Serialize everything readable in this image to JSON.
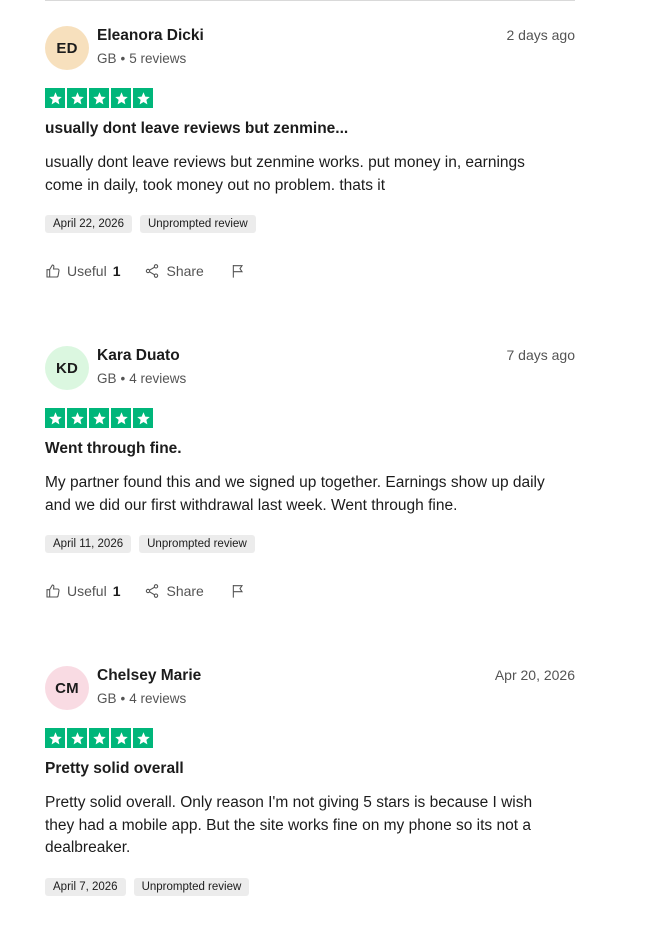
{
  "reviews": [
    {
      "initials": "ED",
      "avatar_color": "#f7e0bd",
      "name": "Eleanora Dicki",
      "country": "GB",
      "review_count": "5 reviews",
      "date": "2 days ago",
      "stars": 5,
      "title": "usually dont leave reviews but zenmine...",
      "body": "usually dont leave reviews but zenmine works. put money in, earnings come in daily, took money out no problem. thats it",
      "experience_date": "April 22, 2026",
      "tag": "Unprompted review",
      "useful_label": "Useful",
      "useful_count": "1",
      "share_label": "Share"
    },
    {
      "initials": "KD",
      "avatar_color": "#dbf7e0",
      "name": "Kara Duato",
      "country": "GB",
      "review_count": "4 reviews",
      "date": "7 days ago",
      "stars": 5,
      "title": "Went through fine.",
      "body": "My partner found this and we signed up together. Earnings show up daily and we did our first withdrawal last week. Went through fine.",
      "experience_date": "April 11, 2026",
      "tag": "Unprompted review",
      "useful_label": "Useful",
      "useful_count": "1",
      "share_label": "Share"
    },
    {
      "initials": "CM",
      "avatar_color": "#f9dbe3",
      "name": "Chelsey Marie",
      "country": "GB",
      "review_count": "4 reviews",
      "date": "Apr 20, 2026",
      "stars": 5,
      "title": "Pretty solid overall",
      "body": "Pretty solid overall. Only reason I'm not giving 5 stars is because I wish they had a mobile app. But the site works fine on my phone so its not a dealbreaker.",
      "experience_date": "April 7, 2026",
      "tag": "Unprompted review"
    }
  ],
  "colors": {
    "star_green": "#00b67a",
    "muted_text": "#545454"
  }
}
